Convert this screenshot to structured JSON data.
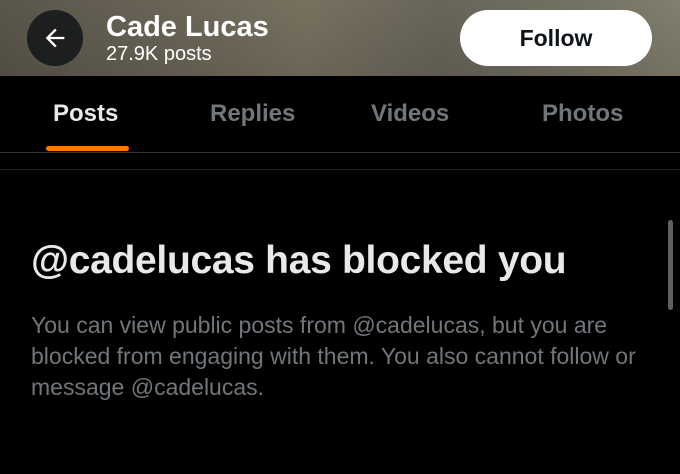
{
  "header": {
    "name": "Cade Lucas",
    "post_count": "27.9K posts",
    "follow_label": "Follow",
    "back_icon": "arrow-left-icon"
  },
  "tabs": [
    {
      "label": "Posts",
      "active": true
    },
    {
      "label": "Replies",
      "active": false
    },
    {
      "label": "Videos",
      "active": false
    },
    {
      "label": "Photos",
      "active": false
    }
  ],
  "blocked": {
    "title": "@cadelucas has blocked you",
    "message": "You can view public posts from @cadelucas, but you are blocked from engaging with them. You also cannot follow or message @cadelucas."
  },
  "colors": {
    "accent_underline": "#ff7a00",
    "background": "#000000",
    "primary_text": "#e7e9ea",
    "secondary_text": "#71767b"
  }
}
